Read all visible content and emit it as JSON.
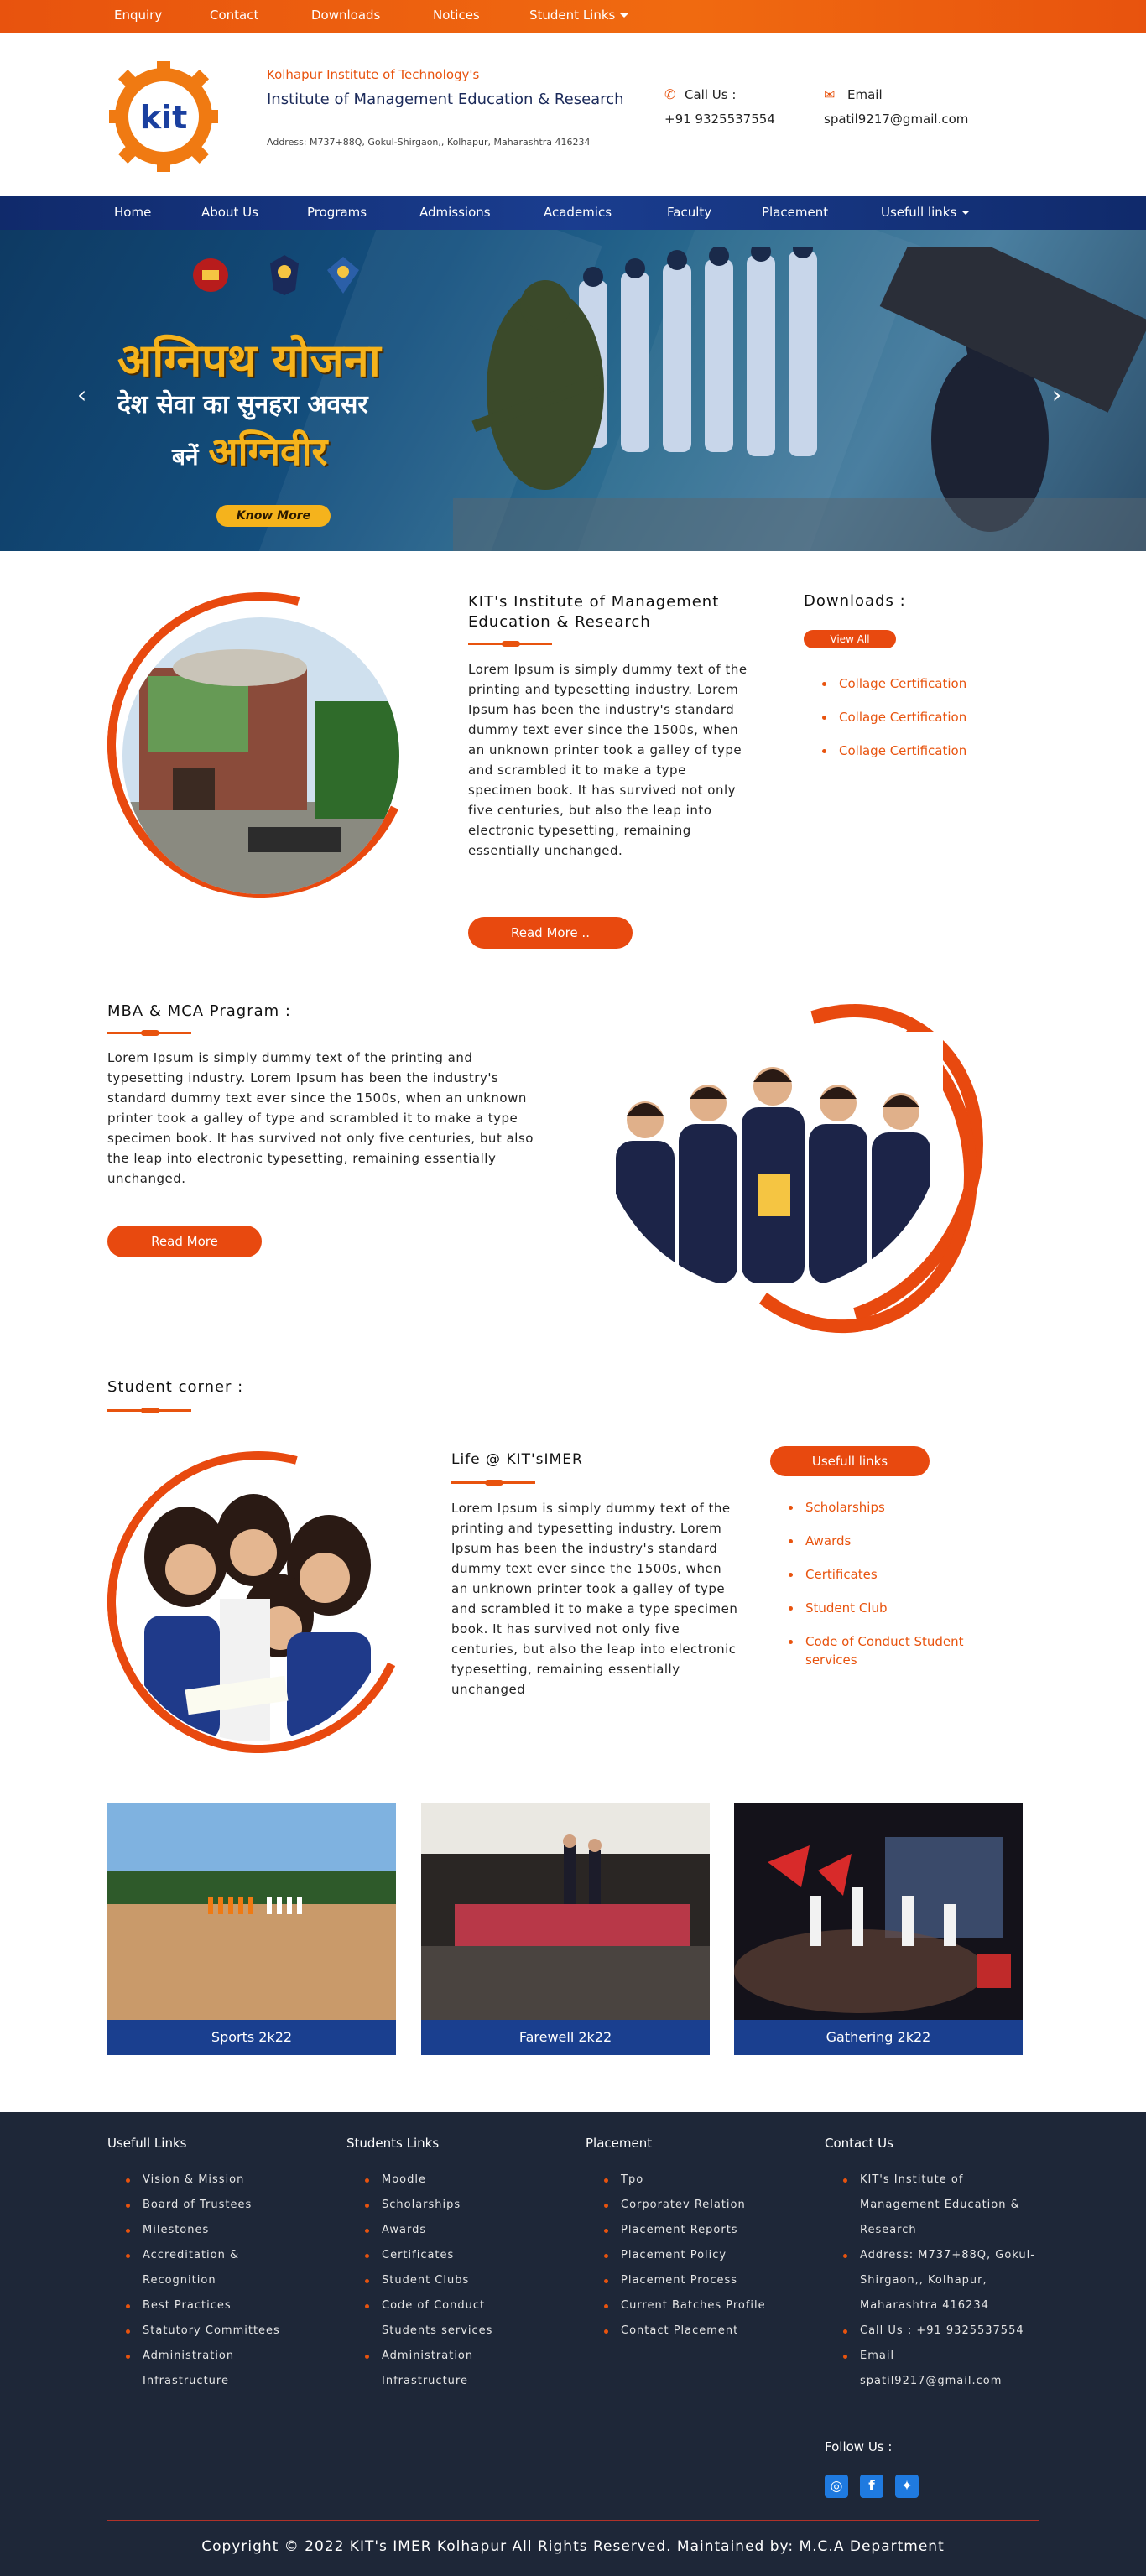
{
  "topbar": {
    "items": [
      "Enquiry",
      "Contact",
      "Downloads",
      "Notices",
      "Student Links"
    ]
  },
  "header": {
    "inst_top": "Kolhapur Institute of Technology's",
    "inst_name": "Institute of Management Education & Research",
    "address": "Address: M737+88Q, Gokul-Shirgaon,, Kolhapur, Maharashtra 416234",
    "call_label": "Call Us :",
    "call_value": "+91 9325537554",
    "email_label": "Email",
    "email_value": "spatil9217@gmail.com",
    "logo_text": "kit"
  },
  "nav": {
    "items": [
      "Home",
      "About Us",
      "Programs",
      "Admissions",
      "Academics",
      "Faculty",
      "Placement",
      "Usefull links"
    ]
  },
  "hero": {
    "line1": "अग्निपथ योजना",
    "line2": "देश सेवा का सुनहरा अवसर",
    "line3_small": "बनें",
    "line3_big": "अग्निवीर",
    "button": "Know More"
  },
  "about": {
    "title": "KIT's Institute of Management Education & Research",
    "text": "Lorem Ipsum is simply dummy text of the printing and typesetting industry. Lorem Ipsum has been the industry's standard dummy text ever since the 1500s, when an unknown printer took a galley of type and scrambled it to make a type specimen book. It has survived not only five centuries, but also the leap into electronic typesetting, remaining essentially unchanged.",
    "button": "Read More .."
  },
  "downloads": {
    "title": "Downloads :",
    "view_all": "View All",
    "items": [
      "Collage Certification",
      "Collage Certification",
      "Collage Certification"
    ]
  },
  "programs": {
    "title": "MBA & MCA Pragram :",
    "text": "Lorem Ipsum is simply dummy text of the printing and typesetting industry. Lorem Ipsum has been the industry's standard dummy text ever since the 1500s, when an unknown printer took a galley of type and scrambled it to make a type specimen book. It has survived not only five centuries, but also the leap into electronic typesetting, remaining essentially unchanged.",
    "button": "Read More"
  },
  "student_corner": {
    "title": "Student corner :",
    "life_title": "Life @ KIT'sIMER",
    "text": "Lorem Ipsum is simply dummy text of the printing and typesetting industry. Lorem Ipsum has been the industry's standard dummy text ever since the 1500s, when an unknown printer took a galley of type and scrambled it to make a type specimen book. It has survived not only five centuries, but also the leap into electronic typesetting, remaining essentially unchanged",
    "links_title": "Usefull links",
    "links": [
      "Scholarships",
      "Awards",
      "Certificates",
      "Student Club",
      "Code of Conduct Student services"
    ]
  },
  "gallery": {
    "items": [
      "Sports 2k22",
      "Farewell 2k22",
      "Gathering 2k22"
    ]
  },
  "footer": {
    "col1": {
      "title": "Usefull Links",
      "items": [
        "Vision & Mission",
        "Board of Trustees",
        "Milestones",
        "Accreditation & Recognition",
        "Best Practices",
        "Statutory Committees",
        "Administration Infrastructure"
      ]
    },
    "col2": {
      "title": "Students Links",
      "items": [
        "Moodle",
        "Scholarships",
        "Awards",
        "Certificates",
        "Student Clubs",
        "Code of Conduct Students services",
        "Administration Infrastructure"
      ]
    },
    "col3": {
      "title": "Placement",
      "items": [
        "Tpo",
        "Corporatev Relation",
        "Placement Reports",
        "Placement Policy",
        "Placement Process",
        "Current Batches Profile",
        "Contact Placement"
      ]
    },
    "col4": {
      "title": "Contact Us",
      "items": [
        "KIT's Institute of Management Education & Research",
        "Address: M737+88Q, Gokul-Shirgaon,, Kolhapur, Maharashtra 416234",
        "Call Us : +91 9325537554",
        "Email spatil9217@gmail.com"
      ]
    },
    "follow": "Follow Us :",
    "copyright": "Copyright © 2022 KIT's IMER Kolhapur All Rights Reserved. Maintained by: M.C.A Department"
  },
  "colors": {
    "accent": "#e8490f",
    "navy": "#102a6b",
    "footer_bg": "#1e2738"
  }
}
